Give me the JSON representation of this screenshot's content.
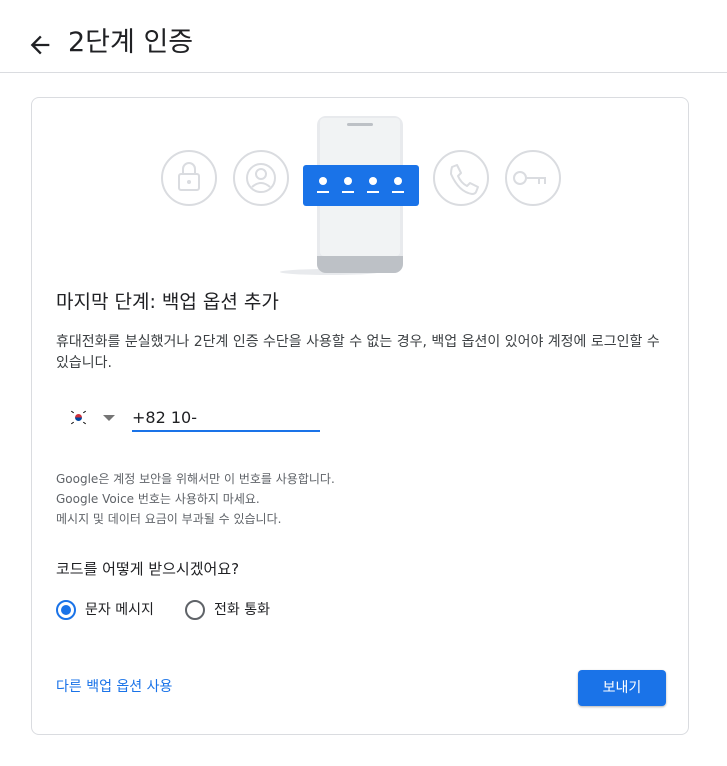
{
  "header": {
    "title": "2단계 인증",
    "back_icon": "arrow-back-icon"
  },
  "main": {
    "step_title": "마지막 단계: 백업 옵션 추가",
    "description": "휴대전화를 분실했거나 2단계 인증 수단을 사용할 수 없는 경우, 백업 옵션이 있어야 계정에 로그인할 수 있습니다.",
    "country_flag": "korea-flag-icon",
    "phone_value": "+82 10-",
    "notes": [
      "Google은 계정 보안을 위해서만 이 번호를 사용합니다.",
      "Google Voice 번호는 사용하지 마세요.",
      "메시지 및 데이터 요금이 부과될 수 있습니다."
    ],
    "question": "코드를 어떻게 받으시겠어요?",
    "options": [
      {
        "label": "문자 메시지",
        "selected": true
      },
      {
        "label": "전화 통화",
        "selected": false
      }
    ],
    "alt_link": "다른 백업 옵션 사용",
    "send_button": "보내기"
  },
  "colors": {
    "accent": "#1a73e8",
    "border": "#dadce0",
    "muted": "#5f6368"
  }
}
